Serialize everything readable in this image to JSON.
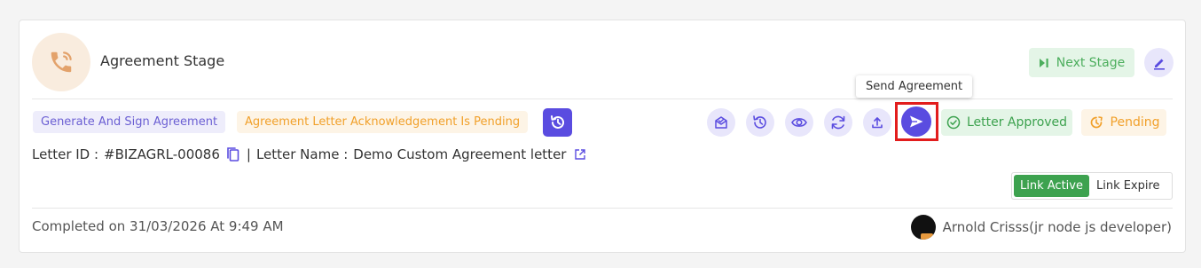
{
  "stage": {
    "title": "Agreement Stage",
    "icon": "phone-icon",
    "next_stage_label": "Next Stage"
  },
  "badges": {
    "type": "Generate And Sign Agreement",
    "status": "Agreement Letter Acknowledgement Is Pending"
  },
  "actions": {
    "tooltip": "Send Agreement",
    "icons": [
      "mail-read-icon",
      "history-icon",
      "eye-icon",
      "refresh-icon",
      "upload-icon",
      "send-icon"
    ]
  },
  "letter_status": {
    "approved_label": "Letter Approved",
    "pending_label": "Pending"
  },
  "letter": {
    "id_label": "Letter ID :",
    "id_value": "#BIZAGRL-00086",
    "separator": "|",
    "name_label": "Letter Name :",
    "name_value": "Demo Custom Agreement letter"
  },
  "link": {
    "active_label": "Link Active",
    "expire_label": "Link Expire"
  },
  "footer": {
    "completed_text": "Completed on 31/03/2026 At 9:49 AM",
    "user_name": "Arnold Crisss(jr node js developer)"
  },
  "colors": {
    "primary": "#5a4ce0",
    "success": "#3da24f",
    "warning": "#f1a02a",
    "highlight": "#e21d1d"
  }
}
